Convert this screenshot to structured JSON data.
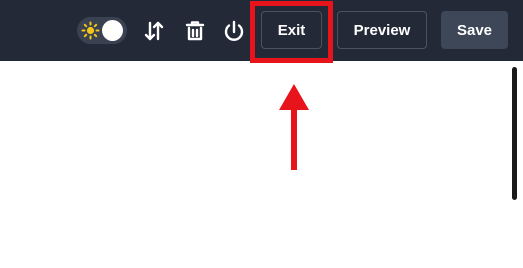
{
  "toolbar": {
    "theme_toggle": {
      "state": "on",
      "icon": "sun-icon"
    },
    "icons": [
      "sort-arrows-icon",
      "trash-icon",
      "power-icon"
    ],
    "exit_label": "Exit",
    "preview_label": "Preview",
    "save_label": "Save"
  },
  "colors": {
    "toolbar_bg": "#232937",
    "save_bg": "#3d4758",
    "sun": "#f5c518",
    "annotation": "#e8141b"
  }
}
